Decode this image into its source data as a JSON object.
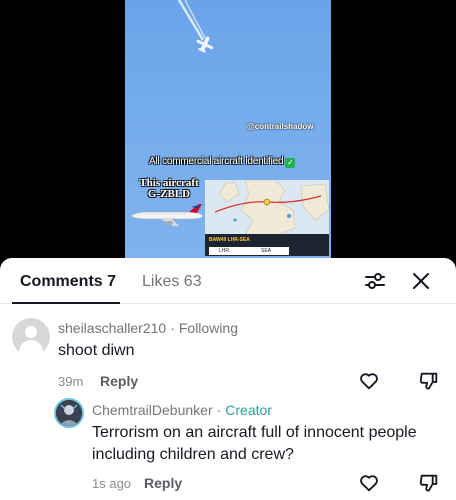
{
  "video": {
    "watermark": "@contrailshadow",
    "headline": "All commercial aircraft identified",
    "check_glyph": "✓",
    "card_label": "This aircraft G-ZBLD",
    "map": {
      "flight_panel_text": "BAW49   LHR-SEA",
      "origin": "LHR",
      "destination": "SEA"
    }
  },
  "comments_sheet": {
    "tabs": {
      "comments_label": "Comments 7",
      "likes_label": "Likes 63"
    },
    "icons": {
      "filter": "sliders-icon",
      "close": "close-icon"
    },
    "comments": [
      {
        "username": "sheilaschaller210",
        "relation": "Following",
        "text": "shoot diwn",
        "time": "39m",
        "reply_label": "Reply",
        "avatar": "default-avatar"
      },
      {
        "username": "ChemtrailDebunker",
        "relation": "Creator",
        "text": "Terrorism on an aircraft full of innocent people including children and crew?",
        "time": "1s ago",
        "reply_label": "Reply",
        "avatar": "creator-avatar"
      }
    ],
    "colors": {
      "creator_accent": "#2aa09b",
      "primary_text": "#161823",
      "secondary_text": "#73757b"
    }
  }
}
